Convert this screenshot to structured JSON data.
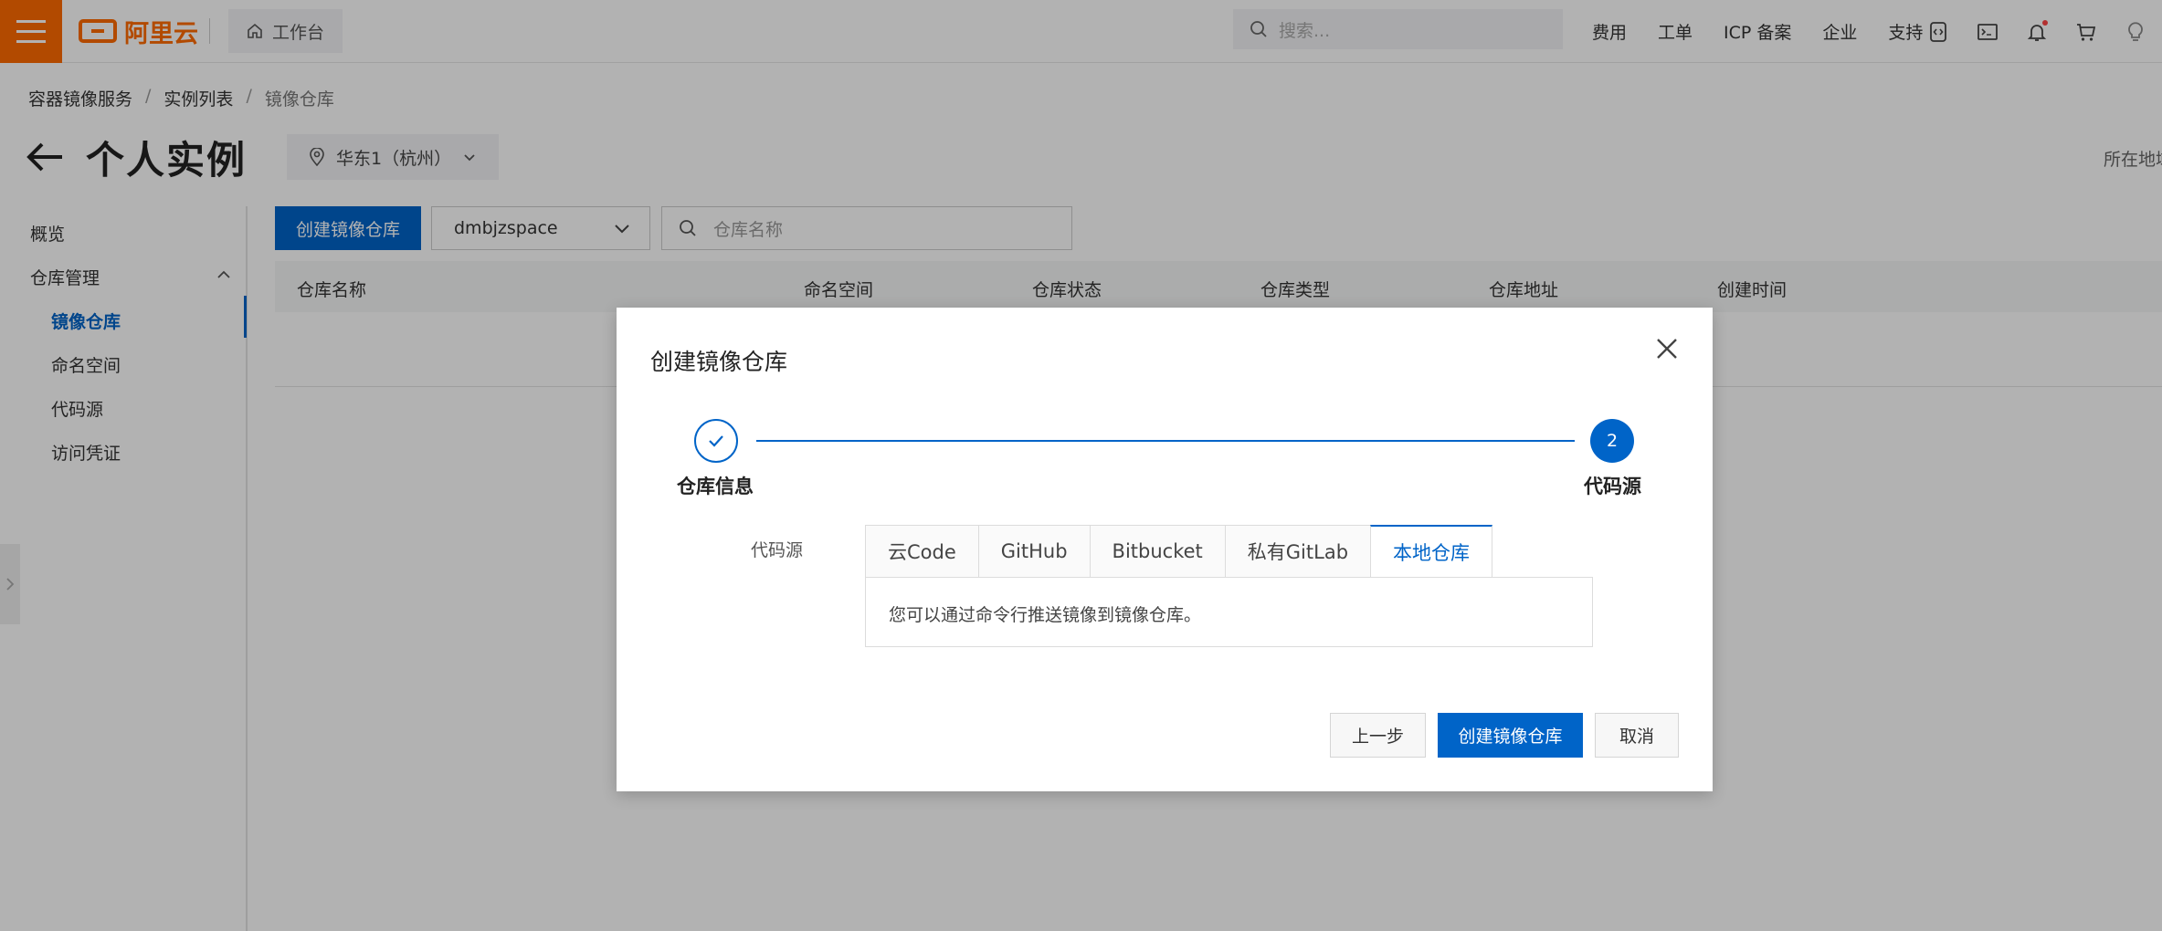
{
  "topbar": {
    "logo_text": "阿里云",
    "workbench_label": "工作台",
    "search_placeholder": "搜索...",
    "nav": [
      "费用",
      "工单",
      "ICP 备案",
      "企业",
      "支持"
    ],
    "icons": [
      "code-icon",
      "terminal-icon",
      "bell-icon",
      "cart-icon",
      "lightbulb-icon"
    ],
    "accent_color": "#ff6a00"
  },
  "breadcrumb": [
    "容器镜像服务",
    "实例列表",
    "镜像仓库"
  ],
  "header": {
    "title": "个人实例",
    "region": "华东1（杭州）",
    "right_hint": "所在地域"
  },
  "sidebar": {
    "items": [
      {
        "label": "概览"
      },
      {
        "label": "仓库管理"
      },
      {
        "label": "镜像仓库"
      },
      {
        "label": "命名空间"
      },
      {
        "label": "代码源"
      },
      {
        "label": "访问凭证"
      }
    ]
  },
  "toolbar": {
    "create_label": "创建镜像仓库",
    "namespace": "dmbjzspace",
    "search_placeholder": "仓库名称"
  },
  "table": {
    "columns": [
      "仓库名称",
      "命名空间",
      "仓库状态",
      "仓库类型",
      "仓库地址",
      "创建时间"
    ]
  },
  "dialog": {
    "title": "创建镜像仓库",
    "steps": [
      {
        "label": "仓库信息",
        "status": "done"
      },
      {
        "label": "代码源",
        "number": "2",
        "status": "current"
      }
    ],
    "source_label": "代码源",
    "tabs": [
      "云Code",
      "GitHub",
      "Bitbucket",
      "私有GitLab",
      "本地仓库"
    ],
    "active_tab": "本地仓库",
    "panel_text": "您可以通过命令行推送镜像到镜像仓库。",
    "buttons": {
      "prev": "上一步",
      "submit": "创建镜像仓库",
      "cancel": "取消"
    },
    "primary_color": "#0064c8"
  }
}
